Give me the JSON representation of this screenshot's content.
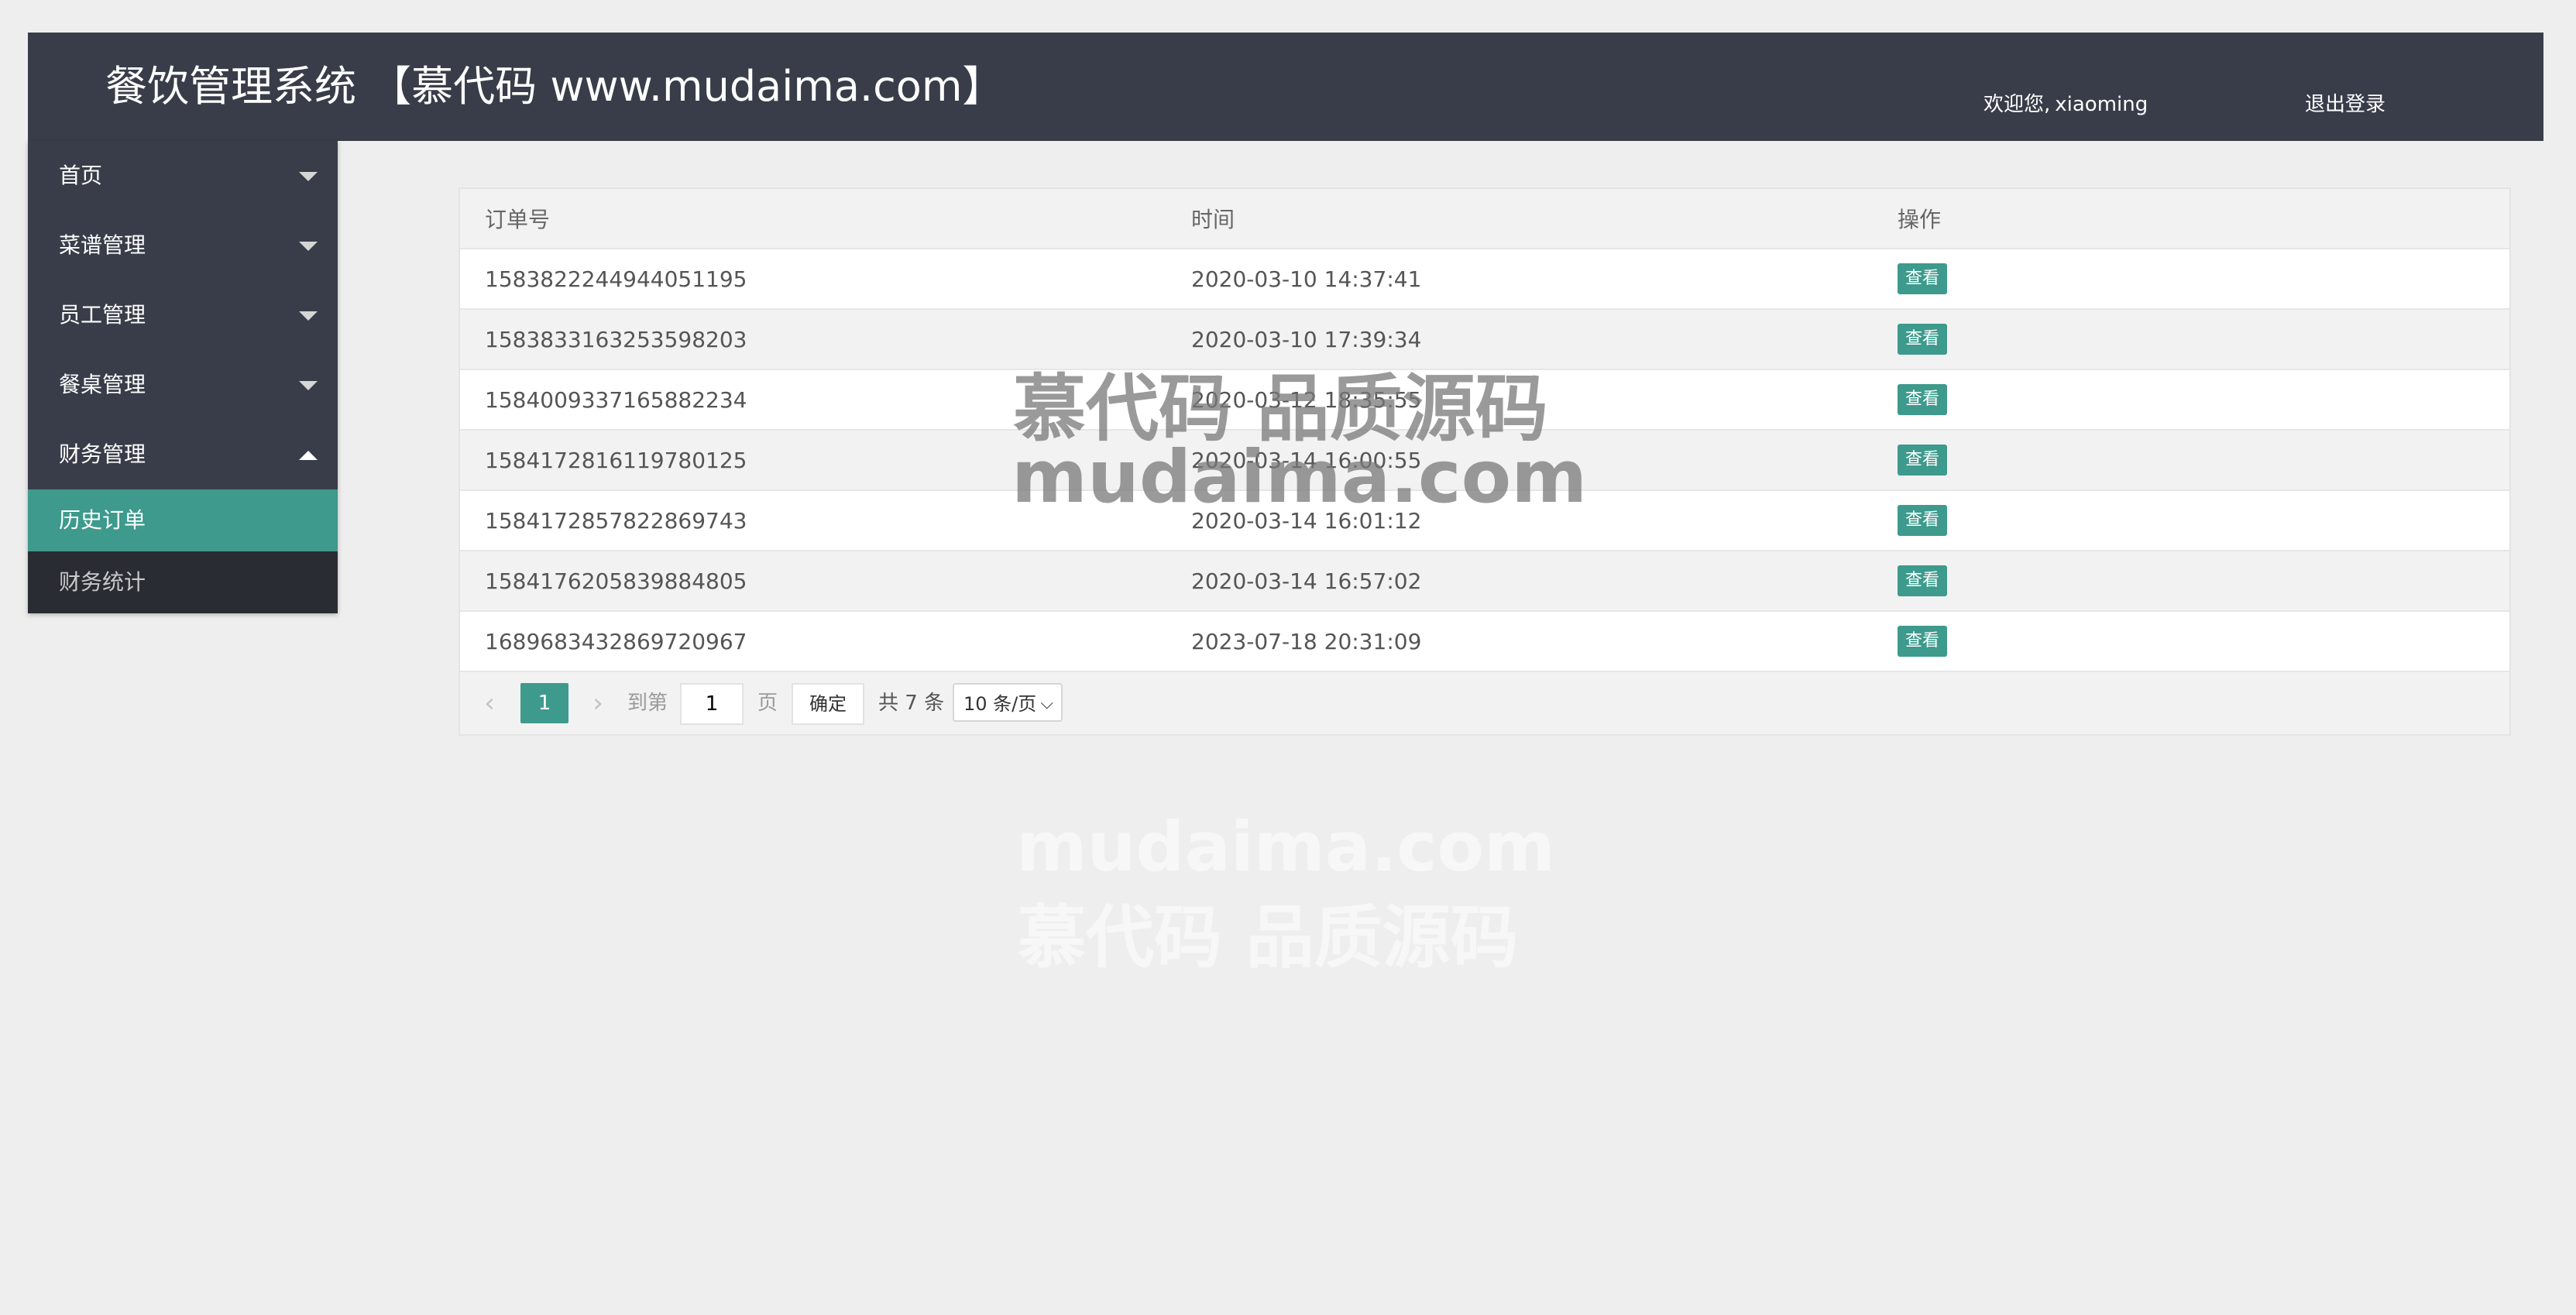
{
  "header": {
    "title": "餐饮管理系统 【慕代码 www.mudaima.com】",
    "welcome_label": "欢迎您,",
    "username": "xiaoming",
    "logout_label": "退出登录"
  },
  "sidebar": {
    "items": [
      {
        "label": "首页"
      },
      {
        "label": "菜谱管理"
      },
      {
        "label": "员工管理"
      },
      {
        "label": "餐桌管理"
      },
      {
        "label": "财务管理"
      }
    ],
    "sub_items": [
      {
        "label": "历史订单"
      },
      {
        "label": "财务统计"
      }
    ]
  },
  "table": {
    "columns": [
      "订单号",
      "时间",
      "操作"
    ],
    "action_label": "查看",
    "rows": [
      {
        "order_no": "1583822244944051195",
        "time": "2020-03-10 14:37:41"
      },
      {
        "order_no": "1583833163253598203",
        "time": "2020-03-10 17:39:34"
      },
      {
        "order_no": "1584009337165882234",
        "time": "2020-03-12 18:35:55"
      },
      {
        "order_no": "1584172816119780125",
        "time": "2020-03-14 16:00:55"
      },
      {
        "order_no": "1584172857822869743",
        "time": "2020-03-14 16:01:12"
      },
      {
        "order_no": "1584176205839884805",
        "time": "2020-03-14 16:57:02"
      },
      {
        "order_no": "1689683432869720967",
        "time": "2023-07-18 20:31:09"
      }
    ]
  },
  "pagination": {
    "prev": "‹",
    "current_page": "1",
    "next": "›",
    "goto_label": "到第",
    "page_input_value": "1",
    "page_label": "页",
    "confirm_label": "确定",
    "total_label": "共 7 条",
    "page_size_label": "10 条/页",
    "chevron": "⌵"
  },
  "watermark": {
    "line1": "慕代码 品质源码",
    "line2": "mudaima.com",
    "line3": "mudaima.com",
    "line4": "慕代码 品质源码"
  },
  "colors": {
    "header_bg": "#393d49",
    "accent": "#3d9a8c",
    "page_bg": "#eeeeee"
  }
}
